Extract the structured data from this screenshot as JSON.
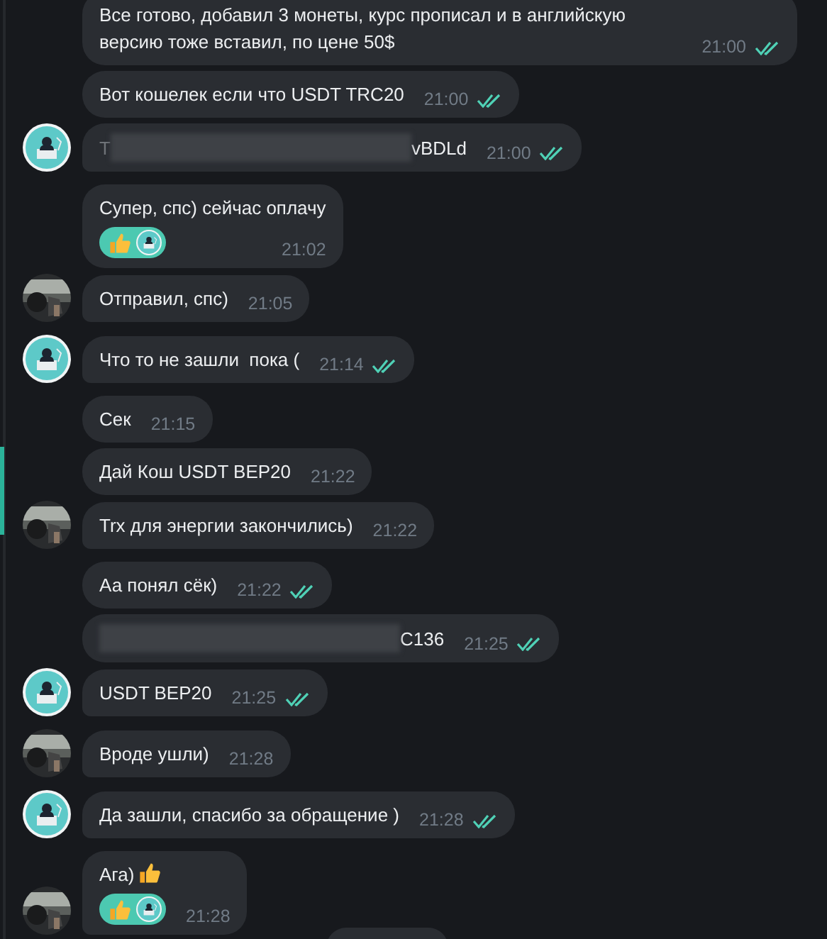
{
  "messages": [
    {
      "text": "Все готово, добавил 3 монеты, курс прописал и в английскую версию тоже вставил, по цене 50$",
      "time": "21:00",
      "read": true
    },
    {
      "text": "Вот кошелек если что USDT TRC20",
      "time": "21:00",
      "read": true
    },
    {
      "kind": "redacted",
      "visible_start": "T",
      "visible_end": "vBDLd",
      "time": "21:00",
      "read": true,
      "avatar": {
        "kind": "illustration"
      }
    },
    {
      "text": "Супер, спс) сейчас оплачу",
      "time": "21:02",
      "read": false,
      "reactions": [
        {
          "kind": "thumb"
        }
      ]
    },
    {
      "text": "Отправил, спс)",
      "time": "21:05",
      "read": false
    },
    {
      "text": "Что то не зашли  пока (",
      "time": "21:14",
      "read": true,
      "avatar": {
        "kind": "illustration"
      }
    },
    {
      "text": "Сек",
      "time": "21:15",
      "read": false
    },
    {
      "text": "Дай Кош USDT BEP20",
      "time": "21:22",
      "read": false
    },
    {
      "text": "Trx для энергии закончились)",
      "time": "21:22",
      "read": false
    },
    {
      "text": "Аа понял сёк)",
      "time": "21:22",
      "read": true
    },
    {
      "kind": "redacted",
      "visible_end": "C136",
      "time": "21:25",
      "read": true
    },
    {
      "text": "USDT BEP20",
      "time": "21:25",
      "read": true,
      "avatar": {
        "kind": "illustration"
      }
    },
    {
      "text": "Вроде ушли)",
      "time": "21:28",
      "read": false
    },
    {
      "text": "Да зашли, спасибо за обращение )",
      "time": "21:28",
      "read": true,
      "avatar": {
        "kind": "illustration"
      }
    },
    {
      "text": "Ага)",
      "trailing_icon": {
        "kind": "thumb"
      },
      "time": "21:28",
      "read": false,
      "reactions": [
        {
          "kind": "thumb"
        }
      ]
    }
  ],
  "next_message_visible": true,
  "side_marker_visible": true
}
